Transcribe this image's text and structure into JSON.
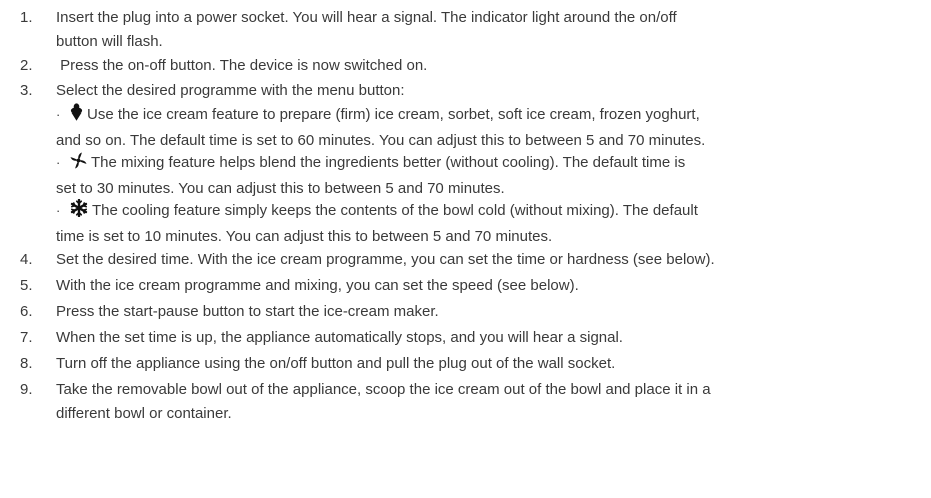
{
  "steps": [
    {
      "number": "1.",
      "lines": [
        "Insert the plug into a power socket. You will hear a signal. The indicator light around the on/off",
        "button will flash."
      ]
    },
    {
      "number": "2.",
      "lines": [
        " Press the on-off button. The device is now switched on."
      ]
    },
    {
      "number": "3.",
      "lines": [
        "Select the desired programme with the menu button:"
      ],
      "sub_items": [
        {
          "bullet": "·",
          "icon": "ice-cream-cone-icon",
          "lines": [
            "Use the ice cream feature to prepare (firm) ice cream, sorbet, soft ice cream, frozen yoghurt,",
            "and so on. The default time is set to 60 minutes. You can adjust this to between 5 and 70 minutes."
          ]
        },
        {
          "bullet": "·",
          "icon": "fan-blades-icon",
          "lines": [
            "The mixing feature helps blend the ingredients better (without cooling).  The default time is",
            "set to 30 minutes. You can adjust this to between 5 and 70 minutes."
          ]
        },
        {
          "bullet": "·",
          "icon": "snowflake-icon",
          "lines": [
            "The cooling feature simply keeps the contents of the bowl cold (without mixing).  The default",
            "time is set to 10 minutes. You can adjust this to between 5 and 70 minutes."
          ]
        }
      ]
    },
    {
      "number": "4.",
      "lines": [
        "Set the desired time. With the ice cream programme, you can set the time or hardness (see below)."
      ]
    },
    {
      "number": "5.",
      "lines": [
        "With the ice cream programme and mixing, you can set the speed (see below)."
      ]
    },
    {
      "number": "6.",
      "lines": [
        "Press the start-pause button to start the ice-cream maker."
      ]
    },
    {
      "number": "7.",
      "lines": [
        "When the set time is up, the appliance automatically stops, and you will hear a signal."
      ]
    },
    {
      "number": "8.",
      "lines": [
        "Turn off the appliance using the on/off button and pull the plug out of the wall socket."
      ]
    },
    {
      "number": "9.",
      "lines": [
        "Take the removable bowl out of the appliance, scoop the ice cream out of the bowl and place it in a",
        "different bowl or container."
      ]
    }
  ]
}
